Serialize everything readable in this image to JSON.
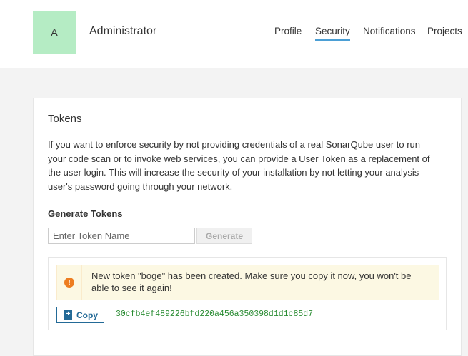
{
  "header": {
    "avatar_letter": "A",
    "user_name": "Administrator",
    "nav": [
      {
        "label": "Profile"
      },
      {
        "label": "Security",
        "active": true
      },
      {
        "label": "Notifications"
      },
      {
        "label": "Projects"
      }
    ]
  },
  "tokens": {
    "title": "Tokens",
    "description": "If you want to enforce security by not providing credentials of a real SonarQube user to run your code scan or to invoke web services, you can provide a User Token as a replacement of the user login. This will increase the security of your installation by not letting your analysis user's password going through your network.",
    "generate_title": "Generate Tokens",
    "input_placeholder": "Enter Token Name",
    "generate_button": "Generate",
    "alert_text": "New token \"boge\" has been created. Make sure you copy it now, you won't be able to see it again!",
    "alert_icon": "exclamation-icon",
    "copy_button": "Copy",
    "token_value": "30cfb4ef489226bfd220a456a350398d1d1c85d7"
  },
  "colors": {
    "avatar": "#b5ecc4",
    "nav_active_underline": "#4b9fd5",
    "alert_background": "#fcf8e3",
    "alert_icon": "#ed7d20",
    "copy_button": "#236a97",
    "token_value": "#2a8c33"
  }
}
